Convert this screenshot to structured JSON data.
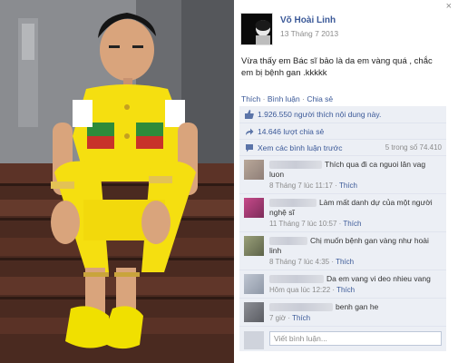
{
  "post": {
    "author": "Võ Hoài Linh",
    "date": "13 Tháng 7 2013",
    "text": "Vừa thấy em Bác sĩ bảo là da em vàng quá , chắc em bị bệnh gan .kkkkk",
    "close_icon": "×"
  },
  "actions": {
    "like": "Thích",
    "comment": "Bình luận",
    "share": "Chia sẻ",
    "sep": " · "
  },
  "stats": {
    "likes": "1.926.550 người thích nội dung này.",
    "shares": "14.646 lượt chia sẻ",
    "view_previous": "Xem các bình luận trước",
    "count": "5 trong số 74.410"
  },
  "comments": [
    {
      "text": "Thích qua đi ca nguoi lân vag luon",
      "time": "8 Tháng 7 lúc 11:17",
      "like": "Thích"
    },
    {
      "text": "Làm mất danh dự của một người nghệ sĩ",
      "time": "11 Tháng 7 lúc 10:57",
      "like": "Thích"
    },
    {
      "text": "Chị muốn bệnh gan vàng như hoài linh",
      "time": "8 Tháng 7 lúc 4:35",
      "like": "Thích"
    },
    {
      "text": "Da em vang vi deo nhieu vang",
      "time": "Hôm qua lúc 12:22",
      "like": "Thích"
    },
    {
      "text": "benh gan he",
      "time": "7 giờ",
      "like": "Thích"
    }
  ],
  "write": {
    "placeholder": "Viết bình luận..."
  },
  "colors": {
    "link": "#3b5998",
    "ufi_bg": "#eceff5",
    "outfit": "#f7e300"
  }
}
